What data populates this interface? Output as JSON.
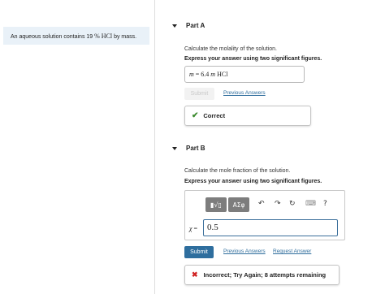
{
  "problem": {
    "text_before": "An aqueous solution contains 19",
    "math": "% HCl",
    "text_after": "by mass."
  },
  "part_a": {
    "header": "Part A",
    "question": "Calculate the molality of the solution.",
    "instruction": "Express your answer using two significant figures.",
    "answer_var": "m",
    "answer_eq": "=",
    "answer_value": "6.4",
    "answer_unit_m": "m",
    "answer_unit_hcl": "HCl",
    "submit_label": "Submit",
    "previous_answers_label": "Previous Answers",
    "feedback": "Correct",
    "feedback_status": "correct",
    "feedback_color": "#3b8a2e"
  },
  "part_b": {
    "header": "Part B",
    "question": "Calculate the mole fraction of the solution.",
    "instruction": "Express your answer using two significant figures.",
    "toolbar": {
      "templates_label": "▮√▯",
      "symbols_label": "ΑΣφ",
      "undo_icon": "↶",
      "redo_icon": "↷",
      "reset_icon": "↻",
      "keyboard_icon": "⌨",
      "help_label": "?"
    },
    "answer_var": "χ",
    "answer_eq": "=",
    "answer_value": "0.5",
    "submit_label": "Submit",
    "previous_answers_label": "Previous Answers",
    "request_answer_label": "Request Answer",
    "feedback": "Incorrect; Try Again; 8 attempts remaining",
    "feedback_status": "incorrect",
    "feedback_color": "#d02222"
  },
  "colors": {
    "link": "#2d6c9c",
    "submit_bg": "#2e6e9e",
    "problem_bg": "#e9f1f8"
  }
}
